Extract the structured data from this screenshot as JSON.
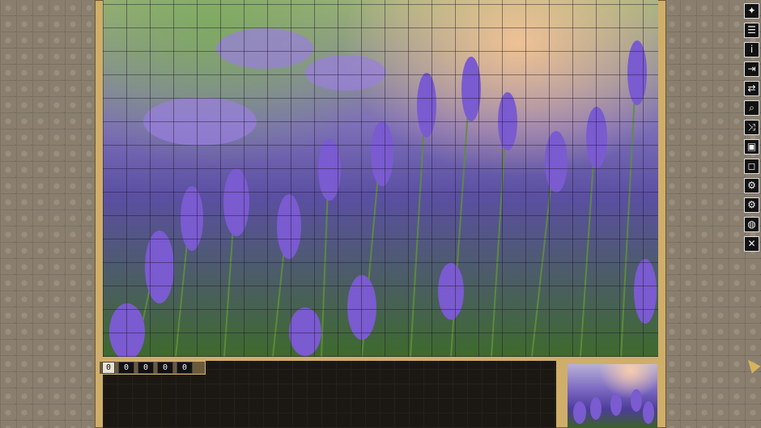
{
  "counter": {
    "digits": [
      "0",
      "0",
      "0",
      "0",
      "0"
    ]
  },
  "toolbar": {
    "icons": [
      {
        "name": "palette-icon",
        "glyph": "✦"
      },
      {
        "name": "list-icon",
        "glyph": "☰"
      },
      {
        "name": "info-icon",
        "glyph": "i"
      },
      {
        "name": "exit-door-icon",
        "glyph": "⇥"
      },
      {
        "name": "sort-icon",
        "glyph": "⇄"
      },
      {
        "name": "magnify-icon",
        "glyph": "⌕"
      },
      {
        "name": "shuffle-icon",
        "glyph": "⤨"
      },
      {
        "name": "ghost-image-icon",
        "glyph": "▣"
      },
      {
        "name": "frame-icon",
        "glyph": "◻"
      },
      {
        "name": "settings-gear-icon",
        "glyph": "⚙"
      },
      {
        "name": "options-gear-icon",
        "glyph": "⚙"
      },
      {
        "name": "globe-icon",
        "glyph": "◍"
      },
      {
        "name": "close-icon",
        "glyph": "✕"
      }
    ]
  },
  "colors": {
    "frame": "#cfae6a",
    "tray": "#1b1814",
    "lavender": "#7a5bd0",
    "stem": "#5f8f3a"
  }
}
